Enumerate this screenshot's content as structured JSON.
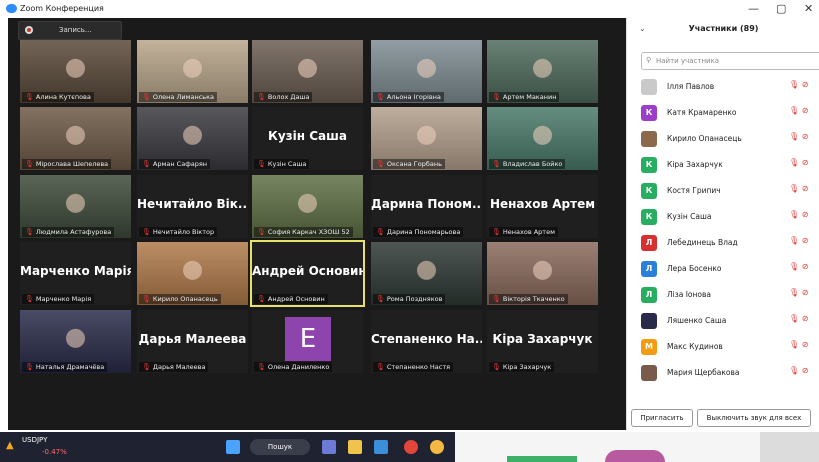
{
  "window": {
    "title": "Zoom Конференция",
    "controls": [
      "—",
      "▢",
      "✕"
    ]
  },
  "record": {
    "label": "Запись..."
  },
  "tiles": [
    {
      "name": "Алина Кутєпова",
      "big": "",
      "bg": "#5a4a3a",
      "speaker": false
    },
    {
      "name": "Олена Лиманська",
      "big": "",
      "bg": "#b8a58a",
      "speaker": false
    },
    {
      "name": "Волох Даша",
      "big": "",
      "bg": "#6b5d52",
      "speaker": false
    },
    {
      "name": "Альона Ігорівна",
      "big": "",
      "bg": "#7f8d93",
      "speaker": false
    },
    {
      "name": "Артем Маканин",
      "big": "",
      "bg": "#4f6b5c",
      "speaker": false
    },
    {
      "name": "Мірослава Шепелева",
      "big": "",
      "bg": "#6e5a47",
      "speaker": false
    },
    {
      "name": "Арман Сафарян",
      "big": "",
      "bg": "#3b3a40",
      "speaker": false
    },
    {
      "name": "Кузін Саша",
      "big": "Кузін Саша",
      "bg": "#1f1f1f",
      "speaker": false
    },
    {
      "name": "Оксана Горбань",
      "big": "",
      "bg": "#b3a08d",
      "speaker": false
    },
    {
      "name": "Владислав Бойко",
      "big": "",
      "bg": "#4a7a6a",
      "speaker": false
    },
    {
      "name": "Людмила Астафурова",
      "big": "",
      "bg": "#3e4a3a",
      "speaker": false
    },
    {
      "name": "Нечитайло Віктор",
      "big": "Нечитайло Вік...",
      "bg": "#1f1f1f",
      "speaker": false
    },
    {
      "name": "София Каркач ХЗОШ 52",
      "big": "",
      "bg": "#5f7046",
      "speaker": false
    },
    {
      "name": "Дарина Пономарьова",
      "big": "Дарина Поном...",
      "bg": "#1f1f1f",
      "speaker": false
    },
    {
      "name": "Ненахов Артем",
      "big": "Ненахов Артем",
      "bg": "#1f1f1f",
      "speaker": false
    },
    {
      "name": "Марченко Марія",
      "big": "Марченко Марія",
      "bg": "#1f1f1f",
      "speaker": false
    },
    {
      "name": "Кирило Опанасець",
      "big": "",
      "bg": "#b07a4a",
      "speaker": false
    },
    {
      "name": "Андрей Основин",
      "big": "Андрей Основин",
      "bg": "#1f1f1f",
      "speaker": true
    },
    {
      "name": "Рома Поздняков",
      "big": "",
      "bg": "#2f3a35",
      "speaker": false
    },
    {
      "name": "Вікторія Ткаченко",
      "big": "",
      "bg": "#8a6a5c",
      "speaker": false
    },
    {
      "name": "Наталья Драмачёва",
      "big": "",
      "bg": "#2a2c4a",
      "speaker": false
    },
    {
      "name": "Дарья Малеева",
      "big": "Дарья Малеева",
      "bg": "#1f1f1f",
      "speaker": false
    },
    {
      "name": "Олена Даниленко",
      "big": "",
      "bg": "#1f1f1f",
      "speaker": false,
      "avatar": "E"
    },
    {
      "name": "Степаненко Настя",
      "big": "Степаненко На...",
      "bg": "#1f1f1f",
      "speaker": false
    },
    {
      "name": "Кіра Захарчук",
      "big": "Кіра Захарчук",
      "bg": "#1f1f1f",
      "speaker": false
    }
  ],
  "participants": {
    "header": "Участники (89)",
    "search_placeholder": "Найти участника",
    "list": [
      {
        "name": "Ілля Павлов",
        "initial": "",
        "color": "#c9c9c9"
      },
      {
        "name": "Катя Крамаренко",
        "initial": "К",
        "color": "#9b3fc9"
      },
      {
        "name": "Кирило Опанасець",
        "initial": "",
        "color": "#8a6a4a"
      },
      {
        "name": "Кіра Захарчук",
        "initial": "К",
        "color": "#27ae60"
      },
      {
        "name": "Костя Грипич",
        "initial": "К",
        "color": "#27ae60"
      },
      {
        "name": "Кузін Саша",
        "initial": "К",
        "color": "#27ae60"
      },
      {
        "name": "Лебединець Влад",
        "initial": "Л",
        "color": "#d63031"
      },
      {
        "name": "Лера Босенко",
        "initial": "Л",
        "color": "#2980d9"
      },
      {
        "name": "Ліза Іонова",
        "initial": "Л",
        "color": "#27ae60"
      },
      {
        "name": "Ляшенко Саша",
        "initial": "",
        "color": "#2a2a4a"
      },
      {
        "name": "Макс Кудинов",
        "initial": "М",
        "color": "#f39c12"
      },
      {
        "name": "Мария Щербакова",
        "initial": "",
        "color": "#7a5a4a"
      }
    ],
    "invite_label": "Пригласить",
    "mute_all_label": "Выключить звук для всех"
  },
  "taskbar": {
    "ticker": "USDJPY",
    "change": "-0.47%",
    "search_label": "Пошук"
  }
}
